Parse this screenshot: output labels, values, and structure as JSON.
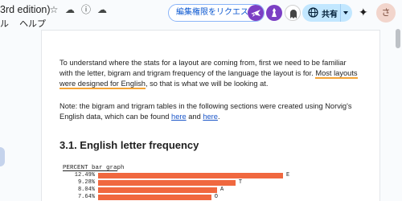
{
  "title_bar": {
    "doc_title": "3rd edition)",
    "menu_items": [
      "ル",
      "ヘルプ"
    ],
    "request_access_label": "編集権限をリクエスト",
    "share_label": "共有",
    "profile_initial": "さ"
  },
  "document": {
    "paragraph1_part1": "To understand where the stats for a layout are coming from, first we need to be familiar",
    "paragraph1_line2": "with the letter, bigram and trigram frequency of the language the layout is for.",
    "paragraph1_highlight_a": "Most layouts",
    "paragraph1_highlight_b": "were designed for English",
    "paragraph1_line3_rest": ", so that is what we will be looking at.",
    "paragraph2_line1": "Note: the bigram and trigram tables in the following sections were created using Norvig's",
    "paragraph2_line2_pre": "English data, which can be found ",
    "link_here_1": "here",
    "paragraph2_and": " and ",
    "link_here_2": "here",
    "paragraph2_end": ".",
    "heading": "3.1. English letter frequency",
    "bar_graph_title": "PERCENT bar graph"
  },
  "chart_data": {
    "type": "bar",
    "title": "PERCENT bar graph",
    "bar_color": "#f0683f",
    "rows": [
      {
        "percent": "12.49%",
        "letter": "E",
        "value": 12.49
      },
      {
        "percent": "9.28%",
        "letter": "T",
        "value": 9.28
      },
      {
        "percent": "8.04%",
        "letter": "A",
        "value": 8.04
      },
      {
        "percent": "7.64%",
        "letter": "O",
        "value": 7.64
      }
    ]
  }
}
